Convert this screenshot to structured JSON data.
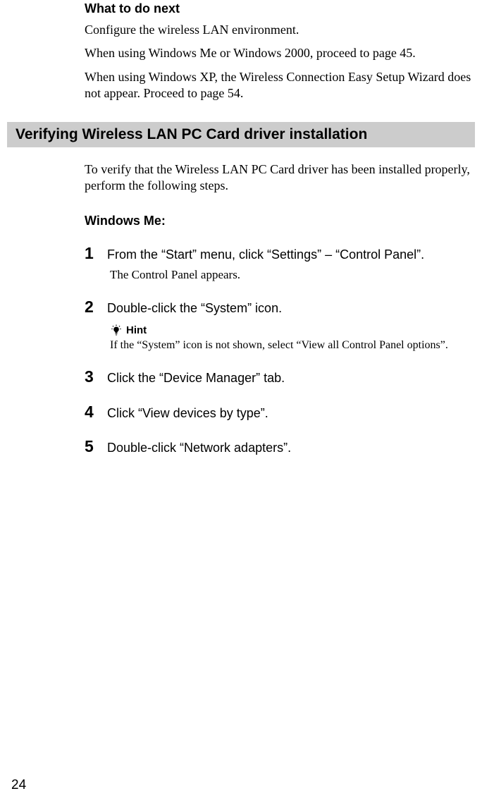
{
  "intro": {
    "heading": "What to do next",
    "p1": "Configure the wireless LAN environment.",
    "p2": "When using Windows Me or Windows 2000, proceed to page 45.",
    "p3": "When using Windows XP, the Wireless Connection Easy Setup Wizard does not appear. Proceed to page 54."
  },
  "section": {
    "title": "Verifying Wireless LAN PC Card driver installation",
    "lead": "To verify that the Wireless LAN PC Card driver has been installed properly, perform the following steps.",
    "subheading": "Windows Me:"
  },
  "steps": [
    {
      "num": "1",
      "text": "From the “Start” menu, click “Settings” – “Control Panel”.",
      "sub": "The Control Panel appears."
    },
    {
      "num": "2",
      "text": "Double-click the “System” icon.",
      "hint_label": "Hint",
      "hint_text": "If the “System” icon is not shown, select “View all Control Panel options”."
    },
    {
      "num": "3",
      "text": "Click the “Device Manager” tab."
    },
    {
      "num": "4",
      "text": "Click “View devices by type”."
    },
    {
      "num": "5",
      "text": "Double-click “Network adapters”."
    }
  ],
  "page_number": "24"
}
